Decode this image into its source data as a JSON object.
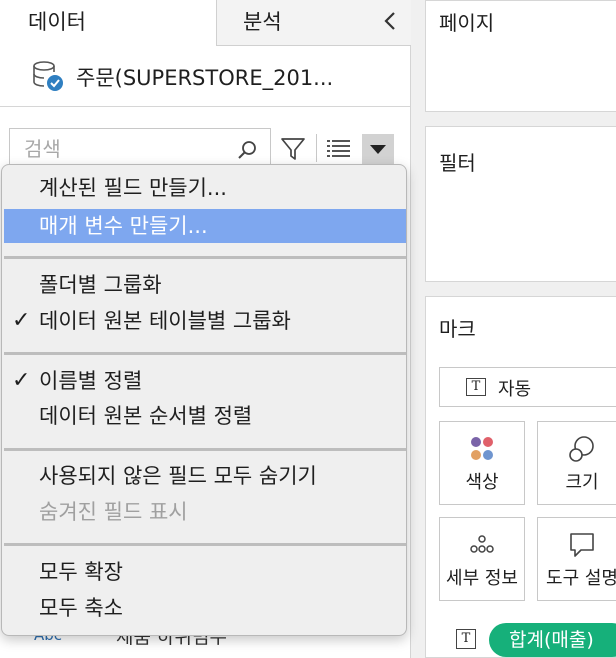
{
  "tabs": {
    "data": "데이터",
    "analysis": "분석"
  },
  "datasource": {
    "name": "주문(SUPERSTORE_201..."
  },
  "search": {
    "placeholder": "검색"
  },
  "background_field": {
    "type": "Abc",
    "name": "제품 하위범주"
  },
  "shelves": {
    "pages": "페이지",
    "filters": "필터",
    "marks": "마크"
  },
  "marks": {
    "type": "자동",
    "tiles": {
      "color": "색상",
      "size": "크기",
      "detail": "세부 정보",
      "tooltip": "도구 설명"
    },
    "pill_icon": "T",
    "pill_label": "합계(매출)"
  },
  "colors": {
    "highlight": "#7ea7ef",
    "measure_pill": "#16b07a"
  },
  "menu": {
    "create_calc_field": "계산된 필드 만들기...",
    "create_parameter": "매개 변수 만들기...",
    "group_by_folder": "폴더별 그룹화",
    "group_by_table": "데이터 원본 테이블별 그룹화",
    "sort_by_name": "이름별 정렬",
    "sort_by_source_order": "데이터 원본 순서별 정렬",
    "hide_unused_fields": "사용되지 않은 필드 모두 숨기기",
    "show_hidden_fields": "숨겨진 필드 표시",
    "expand_all": "모두 확장",
    "collapse_all": "모두 축소",
    "checkmark": "✓"
  }
}
